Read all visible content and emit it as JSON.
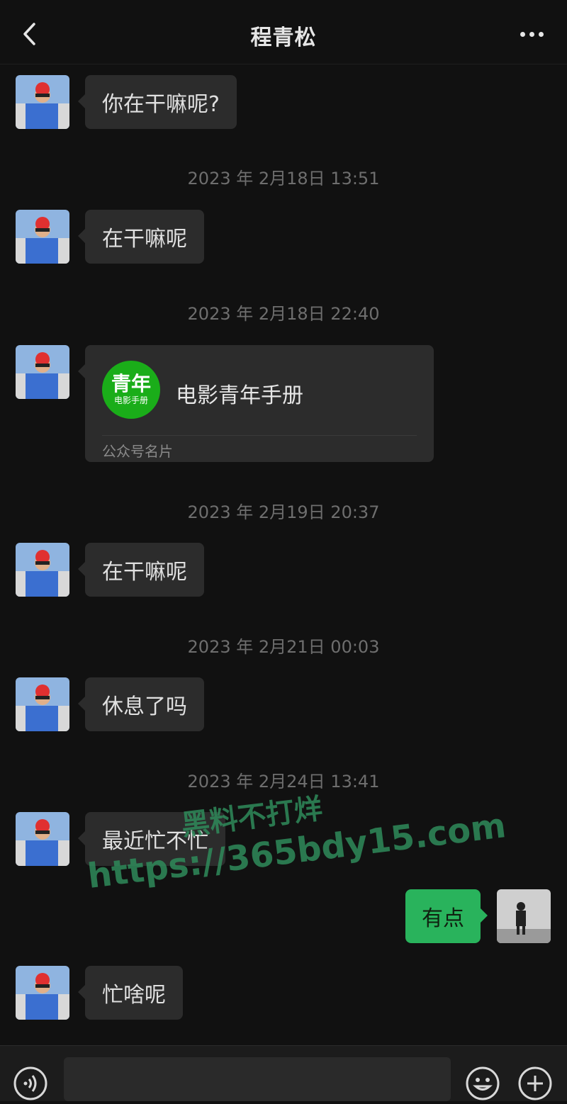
{
  "header": {
    "title": "程青松"
  },
  "messages": [
    {
      "text": "你在干嘛呢?"
    },
    {
      "time": "2023 年 2月18日 13:51",
      "text": "在干嘛呢"
    },
    {
      "time": "2023 年 2月18日 22:40"
    },
    {
      "time": "2023 年 2月19日 20:37",
      "text": "在干嘛呢"
    },
    {
      "time": "2023 年 2月21日 00:03",
      "text": "休息了吗"
    },
    {
      "time": "2023 年 2月24日 13:41",
      "text": "最近忙不忙"
    },
    {
      "text": "忙啥呢"
    }
  ],
  "card": {
    "logo_big": "青年",
    "logo_small": "电影手册",
    "name": "电影青年手册",
    "type": "公众号名片"
  },
  "my_message": {
    "text": "有点"
  },
  "watermark": {
    "line1": "黑料不打烊",
    "line2": "https://365bdy15.com"
  },
  "colors": {
    "background": "#111111",
    "bubble_other": "#2c2c2c",
    "bubble_me": "#29b35c",
    "card_logo": "#1aad19"
  },
  "icons": [
    "back-chevron-icon",
    "more-dots-icon",
    "voice-icon",
    "emoji-icon",
    "plus-icon"
  ]
}
